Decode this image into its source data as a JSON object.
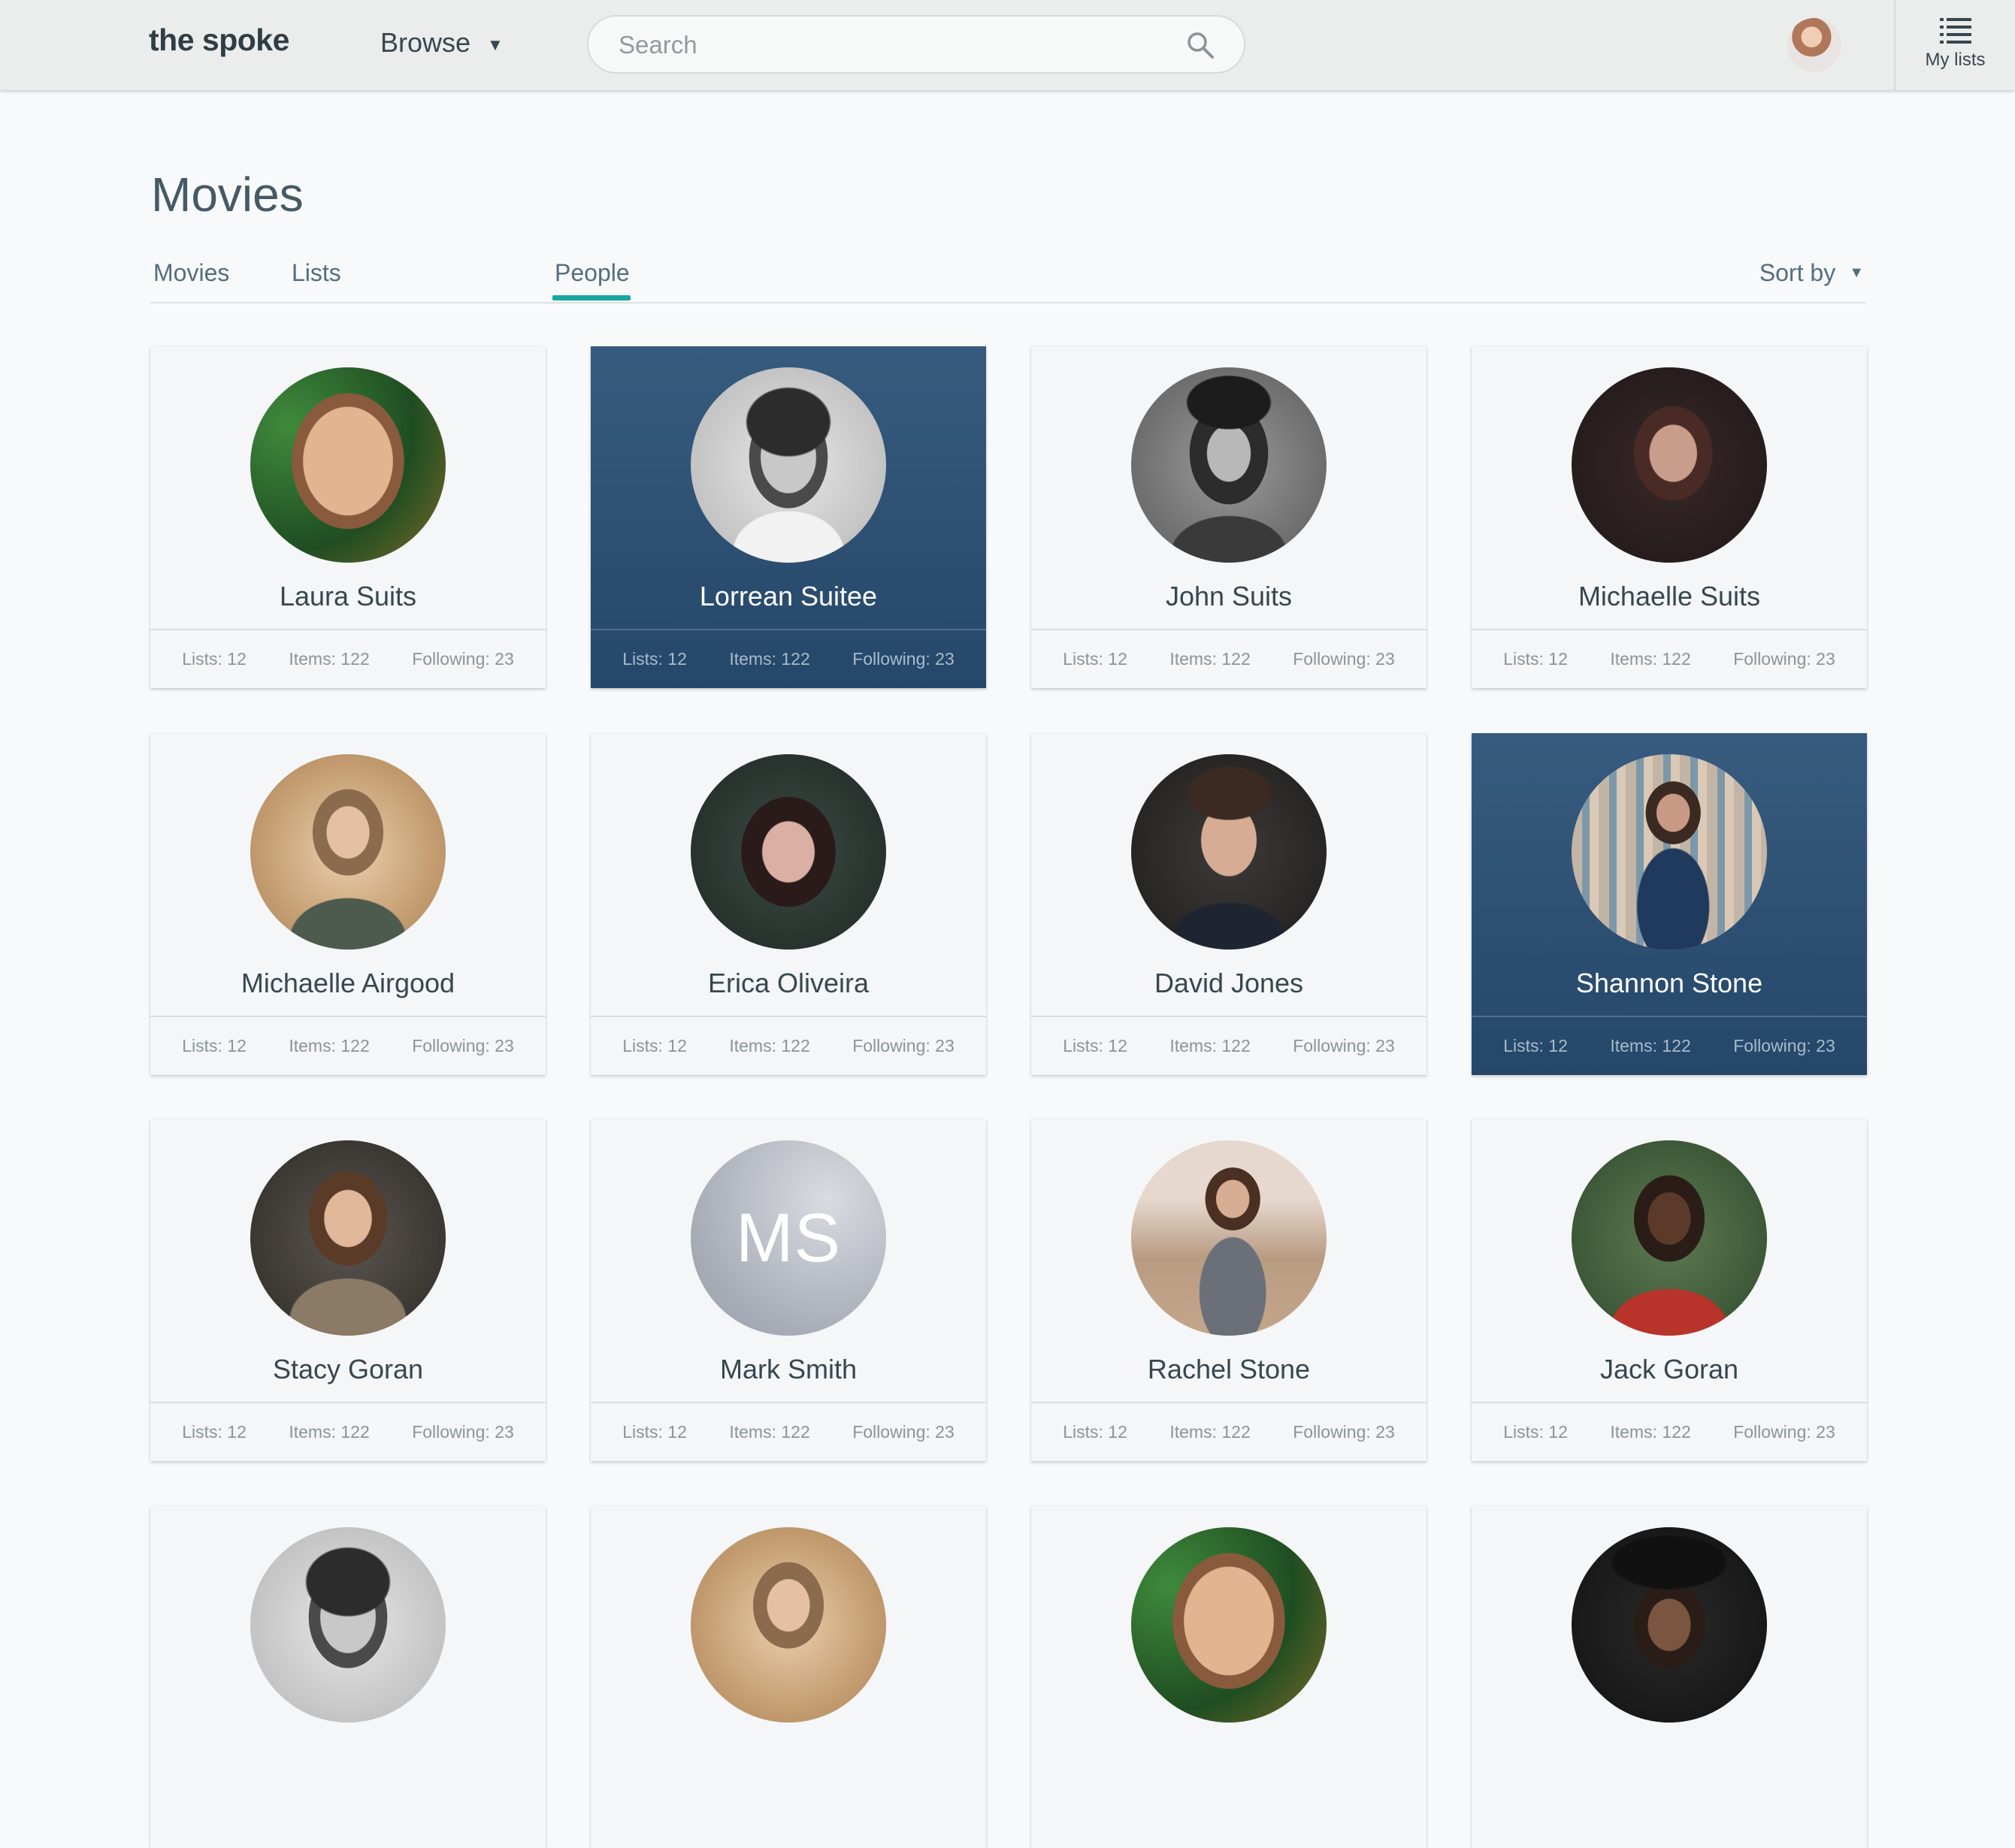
{
  "header": {
    "logo": "the spoke",
    "browse_label": "Browse",
    "search_placeholder": "Search",
    "mylists_label": "My lists"
  },
  "page": {
    "title": "Movies",
    "tabs": [
      "Movies",
      "Lists",
      "People"
    ],
    "active_tab": "People",
    "sort_label": "Sort by"
  },
  "colors": {
    "accent": "#19a7a1",
    "card_highlight": "#2f5377",
    "header_bg": "#ebecec"
  },
  "people": [
    {
      "name": "Laura Suits",
      "lists": "Lists: 12",
      "items": "Items: 122",
      "following": "Following: 23",
      "highlighted": false,
      "avatar": "photo"
    },
    {
      "name": "Lorrean Suitee",
      "lists": "Lists: 12",
      "items": "Items: 122",
      "following": "Following: 23",
      "highlighted": true,
      "avatar": "photo"
    },
    {
      "name": "John Suits",
      "lists": "Lists: 12",
      "items": "Items: 122",
      "following": "Following: 23",
      "highlighted": false,
      "avatar": "photo"
    },
    {
      "name": "Michaelle Suits",
      "lists": "Lists: 12",
      "items": "Items: 122",
      "following": "Following: 23",
      "highlighted": false,
      "avatar": "photo"
    },
    {
      "name": "Michaelle Airgood",
      "lists": "Lists: 12",
      "items": "Items: 122",
      "following": "Following: 23",
      "highlighted": false,
      "avatar": "photo"
    },
    {
      "name": "Erica Oliveira",
      "lists": "Lists: 12",
      "items": "Items: 122",
      "following": "Following: 23",
      "highlighted": false,
      "avatar": "photo"
    },
    {
      "name": "David Jones",
      "lists": "Lists: 12",
      "items": "Items: 122",
      "following": "Following: 23",
      "highlighted": false,
      "avatar": "photo"
    },
    {
      "name": "Shannon Stone",
      "lists": "Lists: 12",
      "items": "Items: 122",
      "following": "Following: 23",
      "highlighted": true,
      "avatar": "photo"
    },
    {
      "name": "Stacy Goran",
      "lists": "Lists: 12",
      "items": "Items: 122",
      "following": "Following: 23",
      "highlighted": false,
      "avatar": "photo"
    },
    {
      "name": "Mark Smith",
      "lists": "Lists: 12",
      "items": "Items: 122",
      "following": "Following: 23",
      "highlighted": false,
      "avatar": "initials",
      "initials": "MS"
    },
    {
      "name": "Rachel Stone",
      "lists": "Lists: 12",
      "items": "Items: 122",
      "following": "Following: 23",
      "highlighted": false,
      "avatar": "photo"
    },
    {
      "name": "Jack Goran",
      "lists": "Lists: 12",
      "items": "Items: 122",
      "following": "Following: 23",
      "highlighted": false,
      "avatar": "photo"
    },
    {
      "name": "",
      "highlighted": false,
      "avatar": "photo"
    },
    {
      "name": "",
      "highlighted": false,
      "avatar": "photo"
    },
    {
      "name": "",
      "highlighted": false,
      "avatar": "photo"
    },
    {
      "name": "",
      "highlighted": false,
      "avatar": "photo"
    }
  ]
}
